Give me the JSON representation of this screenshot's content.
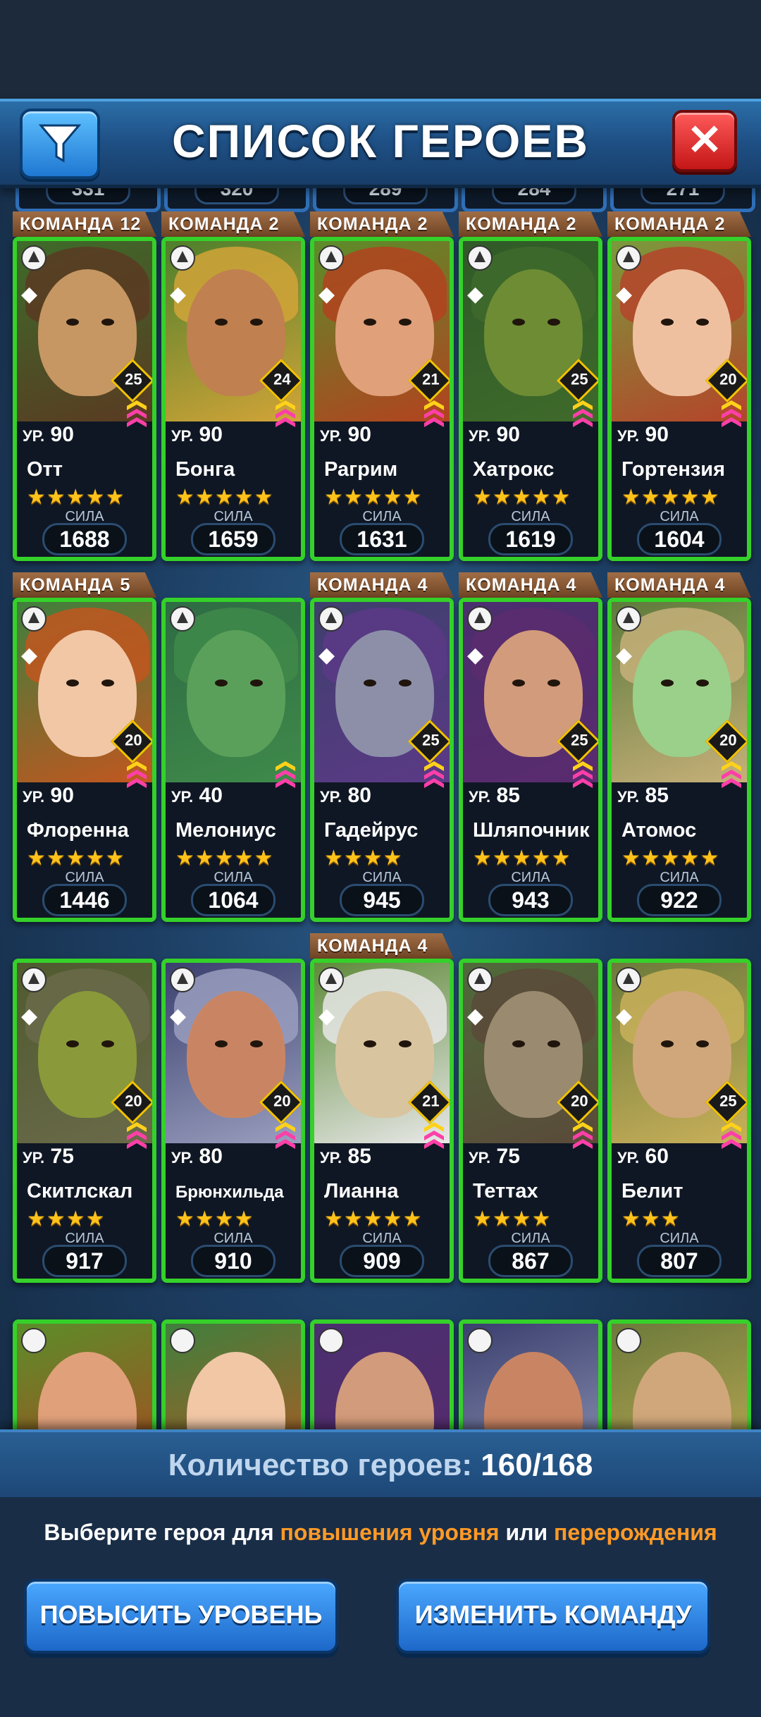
{
  "header": {
    "title": "СПИСОК ГЕРОЕВ"
  },
  "top_partial_values": [
    "331",
    "320",
    "289",
    "284",
    "271"
  ],
  "labels": {
    "level_prefix": "УР.",
    "power_label": "СИЛА"
  },
  "heroes": [
    {
      "team": "КОМАНДА 12",
      "class_icon": "fist-icon",
      "element_icon": "leaf-icon",
      "limit": "25",
      "level": "90",
      "name": "Отт",
      "stars": "★★★★★",
      "power": "1688"
    },
    {
      "team": "КОМАНДА 2",
      "class_icon": "fist-icon",
      "element_icon": "flower-icon",
      "limit": "24",
      "level": "90",
      "name": "Бонга",
      "stars": "★★★★★",
      "power": "1659"
    },
    {
      "team": "КОМАНДА 2",
      "class_icon": "feather-icon",
      "element_icon": "potion-icon",
      "limit": "21",
      "level": "90",
      "name": "Рагрим",
      "stars": "★★★★★",
      "power": "1631"
    },
    {
      "team": "КОМАНДА 2",
      "class_icon": "hammer-icon",
      "element_icon": "shield-icon",
      "limit": "25",
      "level": "90",
      "name": "Хатрокс",
      "stars": "★★★★★",
      "power": "1619"
    },
    {
      "team": "КОМАНДА 2",
      "class_icon": "feather-icon",
      "element_icon": "snake-icon",
      "limit": "20",
      "level": "90",
      "name": "Гортензия",
      "stars": "★★★★★",
      "power": "1604"
    },
    {
      "team": "КОМАНДА 5",
      "class_icon": "feather-icon",
      "element_icon": "badge-2025-icon",
      "limit": "20",
      "level": "90",
      "name": "Флоренна",
      "stars": "★★★★★",
      "power": "1446"
    },
    {
      "team": "",
      "class_icon": "carrot-icon",
      "element_icon": "",
      "limit": "",
      "level": "40",
      "name": "Мелониус",
      "stars": "★★★★★",
      "power": "1064"
    },
    {
      "team": "КОМАНДА 4",
      "class_icon": "shield-icon",
      "element_icon": "swirl-icon",
      "limit": "25",
      "level": "80",
      "name": "Гадейрус",
      "stars": "★★★★",
      "power": "945"
    },
    {
      "team": "КОМАНДА 4",
      "class_icon": "sun-icon",
      "element_icon": "mask-icon",
      "limit": "25",
      "level": "85",
      "name": "Шляпочник",
      "stars": "★★★★★",
      "power": "943"
    },
    {
      "team": "КОМАНДА 4",
      "class_icon": "hammer-icon",
      "element_icon": "swirl-icon",
      "limit": "20",
      "level": "85",
      "name": "Атомос",
      "stars": "★★★★★",
      "power": "922"
    },
    {
      "team": "",
      "class_icon": "pentagram-icon",
      "element_icon": "trophy-icon",
      "limit": "20",
      "level": "75",
      "name": "Скитлскал",
      "stars": "★★★★",
      "power": "917"
    },
    {
      "team": "",
      "class_icon": "sword-icon",
      "element_icon": "shield-icon",
      "limit": "20",
      "level": "80",
      "name": "Брюнхильда",
      "stars": "★★★★",
      "power": "910"
    },
    {
      "team": "КОМАНДА 4",
      "class_icon": "bow-icon",
      "element_icon": "trophy-icon",
      "limit": "21",
      "level": "85",
      "name": "Лианна",
      "stars": "★★★★★",
      "power": "909"
    },
    {
      "team": "",
      "class_icon": "fist-icon",
      "element_icon": "mask-icon",
      "limit": "20",
      "level": "75",
      "name": "Теттах",
      "stars": "★★★★",
      "power": "867"
    },
    {
      "team": "",
      "class_icon": "feather-icon",
      "element_icon": "trophy-icon",
      "limit": "25",
      "level": "60",
      "name": "Белит",
      "stars": "★★★",
      "power": "807"
    }
  ],
  "footer": {
    "count_label": "Количество героев:",
    "count_value": "160/168",
    "hint_prefix": "Выберите героя для",
    "hint_level": "повышения уровня",
    "hint_or": "или",
    "hint_rebirth": "перерождения",
    "btn_level_up": "ПОВЫСИТЬ УРОВЕНЬ",
    "btn_change_team": "ИЗМЕНИТЬ КОМАНДУ"
  },
  "colors": {
    "card_border": "#35d12a",
    "accent_orange": "#ff9a26",
    "header_blue": "#1e4f84"
  }
}
